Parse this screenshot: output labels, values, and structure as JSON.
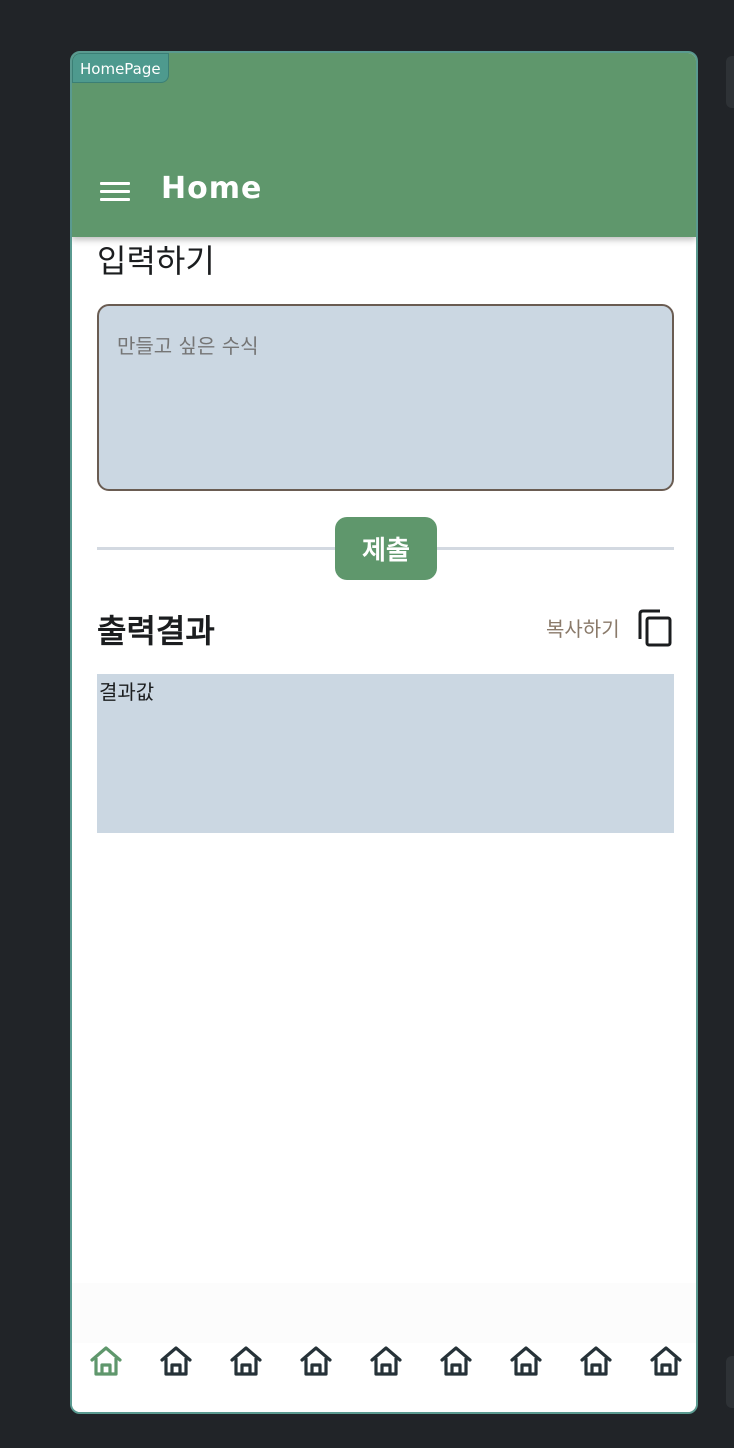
{
  "page_tag": "HomePage",
  "app_bar": {
    "title": "Home"
  },
  "input": {
    "heading": "입력하기",
    "placeholder": "만들고 싶은 수식",
    "value": ""
  },
  "submit": {
    "label": "제출"
  },
  "output": {
    "heading": "출력결과",
    "copy_label": "복사하기",
    "result": "결과값"
  },
  "bottom_nav": {
    "items": [
      {
        "icon": "home-icon",
        "active": true
      },
      {
        "icon": "home-icon",
        "active": false
      },
      {
        "icon": "home-icon",
        "active": false
      },
      {
        "icon": "home-icon",
        "active": false
      },
      {
        "icon": "home-icon",
        "active": false
      },
      {
        "icon": "home-icon",
        "active": false
      },
      {
        "icon": "home-icon",
        "active": false
      },
      {
        "icon": "home-icon",
        "active": false
      },
      {
        "icon": "home-icon",
        "active": false
      }
    ]
  },
  "colors": {
    "primary": "#5f976c",
    "active_icon": "#5f976c",
    "inactive_icon": "#263238",
    "field_bg": "#cbd7e2",
    "background": "#212428"
  }
}
